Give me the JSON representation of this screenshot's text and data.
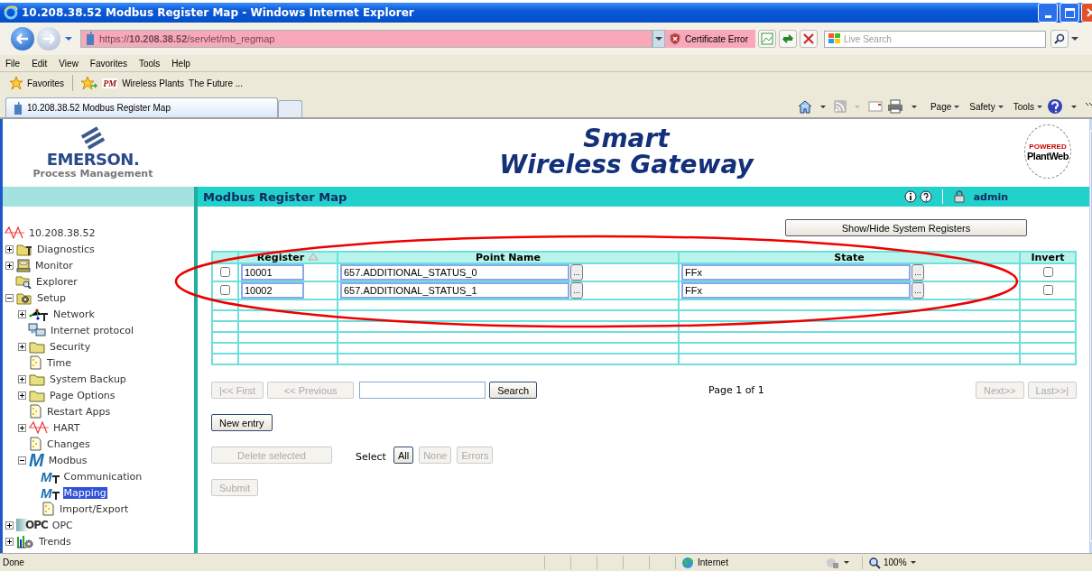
{
  "window": {
    "title": "10.208.38.52 Modbus Register Map - Windows Internet Explorer"
  },
  "address_bar": {
    "url": "https://**10.208.38.52**/servlet/mb_regmap",
    "certificate": "Certificate Error",
    "search_placeholder": "Live Search"
  },
  "menu": [
    "File",
    "Edit",
    "View",
    "Favorites",
    "Tools",
    "Help"
  ],
  "favorites_bar": {
    "label": "Favorites",
    "logo": "PM",
    "links": [
      "Wireless Plants",
      "The Future ..."
    ]
  },
  "tabs": [
    {
      "label": "10.208.38.52 Modbus Register Map",
      "selected": true
    }
  ],
  "command_bar": [
    "Page",
    "Safety",
    "Tools"
  ],
  "header": {
    "brand": "EMERSON.",
    "brand_sub": "Process Management",
    "title_line1": "Smart",
    "title_line2": "Wireless Gateway",
    "badge_top": "POWERED",
    "badge": "PlantWeb"
  },
  "banner": {
    "title": "Modbus Register Map",
    "user": "admin"
  },
  "sidebar": {
    "root": "10.208.38.52",
    "tree": [
      {
        "label": "Diagnostics",
        "kind": "diagnostics",
        "expanded": false,
        "selected": false
      },
      {
        "label": "Monitor",
        "kind": "monitor",
        "expanded": false,
        "selected": false
      },
      {
        "label": "Explorer",
        "kind": "explorer",
        "selected": false
      },
      {
        "label": "Setup",
        "kind": "setup",
        "expanded": true,
        "selected": false,
        "children": [
          {
            "label": "Network",
            "kind": "network",
            "expanded": false,
            "selected": false
          },
          {
            "label": "Internet protocol",
            "kind": "computer",
            "selected": false
          },
          {
            "label": "Security",
            "kind": "folder",
            "expanded": false,
            "selected": false
          },
          {
            "label": "Time",
            "kind": "page",
            "selected": false
          },
          {
            "label": "System Backup",
            "kind": "folder",
            "expanded": false,
            "selected": false
          },
          {
            "label": "Page Options",
            "kind": "folder",
            "expanded": false,
            "selected": false
          },
          {
            "label": "Restart Apps",
            "kind": "page",
            "selected": false
          },
          {
            "label": "HART",
            "kind": "wave",
            "expanded": false,
            "selected": false
          },
          {
            "label": "Changes",
            "kind": "page",
            "selected": false
          },
          {
            "label": "Modbus",
            "kind": "modbus",
            "logo": "M",
            "expanded": true,
            "selected": false,
            "children": [
              {
                "label": "Communication",
                "kind": "modbus-tool",
                "logo": "M",
                "selected": false
              },
              {
                "label": "Mapping",
                "kind": "modbus-tool",
                "logo": "M",
                "selected": true
              },
              {
                "label": "Import/Export",
                "kind": "page",
                "selected": false
              }
            ]
          }
        ]
      },
      {
        "label": "OPC",
        "kind": "opc",
        "logo": "OPC",
        "expanded": false,
        "selected": false
      },
      {
        "label": "Trends",
        "kind": "trends",
        "expanded": false,
        "selected": false
      }
    ]
  },
  "toggle_button": "Show/Hide System Registers",
  "table": {
    "columns": [
      {
        "label": "Register",
        "sorted": true
      },
      {
        "label": "Point Name",
        "sorted": false
      },
      {
        "label": "State",
        "sorted": false
      },
      {
        "label": "Invert",
        "sorted": false
      }
    ],
    "rows": [
      {
        "kind": "entry",
        "selected": false,
        "register": "10001",
        "point_name": "657.ADDITIONAL_STATUS_0",
        "point_button": "...",
        "state": "FFx",
        "state_button": "...",
        "invert": false
      },
      {
        "kind": "entry",
        "selected": false,
        "register": "10002",
        "point_name": "657.ADDITIONAL_STATUS_1",
        "point_button": "...",
        "state": "FFx",
        "state_button": "...",
        "invert": false
      },
      {
        "kind": "blank"
      },
      {
        "kind": "blank"
      },
      {
        "kind": "blank"
      },
      {
        "kind": "blank"
      },
      {
        "kind": "blank"
      },
      {
        "kind": "blank"
      }
    ]
  },
  "pager": {
    "first": {
      "label": "|<< First",
      "disabled": true
    },
    "previous": {
      "label": "<< Previous",
      "disabled": true
    },
    "search": {
      "label": "Search",
      "disabled": false
    },
    "page_info": "Page 1 of 1",
    "next": {
      "label": "Next>>",
      "disabled": true
    },
    "last": {
      "label": "Last>>|",
      "disabled": true
    }
  },
  "new_entry": {
    "label": "New entry",
    "disabled": false
  },
  "delete_selected": {
    "label": "Delete selected",
    "disabled": true
  },
  "select": {
    "label": "Select",
    "options": [
      {
        "label": "All",
        "disabled": false
      },
      {
        "label": "None",
        "disabled": true
      },
      {
        "label": "Errors",
        "disabled": true
      }
    ]
  },
  "submit": {
    "label": "Submit",
    "disabled": true
  },
  "status_bar": {
    "text": "Done",
    "zone": "Internet",
    "zoom": "100%"
  }
}
